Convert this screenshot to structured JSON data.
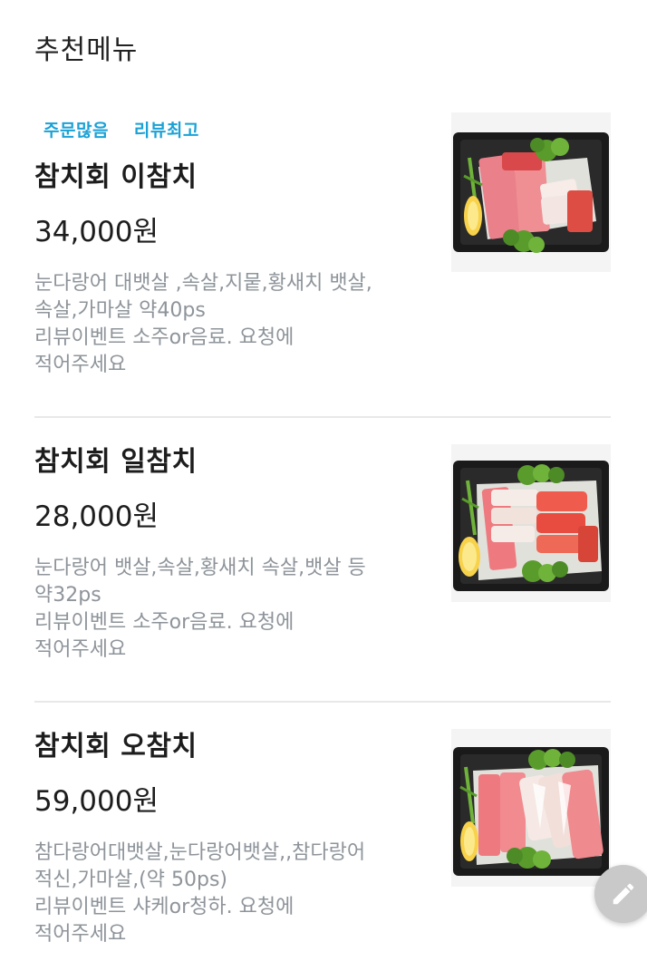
{
  "section": {
    "title": "추천메뉴"
  },
  "items": [
    {
      "badges": [
        "주문많음",
        "리뷰최고"
      ],
      "name": "참치회 이참치",
      "price": "34,000원",
      "desc_lines": [
        "눈다랑어 대뱃살 ,속살,지뭍,황새치 뱃살,",
        "속살,가마살 약40ps",
        "리뷰이벤트 소주or음료. 요청에",
        "적어주세요"
      ],
      "photo_icon": "tuna-sashimi-platter-image"
    },
    {
      "badges": [],
      "name": "참치회 일참치",
      "price": "28,000원",
      "desc_lines": [
        "눈다랑어 뱃살,속살,황새치 속살,뱃살 등",
        "약32ps",
        "리뷰이벤트 소주or음료. 요청에",
        "적어주세요"
      ],
      "photo_icon": "tuna-sashimi-platter-image"
    },
    {
      "badges": [],
      "name": "참치회 오참치",
      "price": "59,000원",
      "desc_lines": [
        "참다랑어대뱃살,눈다랑어뱃살,,참다랑어",
        "적신,가마살,(약 50ps)",
        "리뷰이벤트 샤케or청하. 요청에",
        "적어주세요"
      ],
      "photo_icon": "tuna-sashimi-platter-image"
    }
  ],
  "fab": {
    "icon": "pencil-icon"
  },
  "colors": {
    "badge": "#1ba1d6",
    "desc": "#8e949a",
    "divider": "#e8e8e8"
  }
}
